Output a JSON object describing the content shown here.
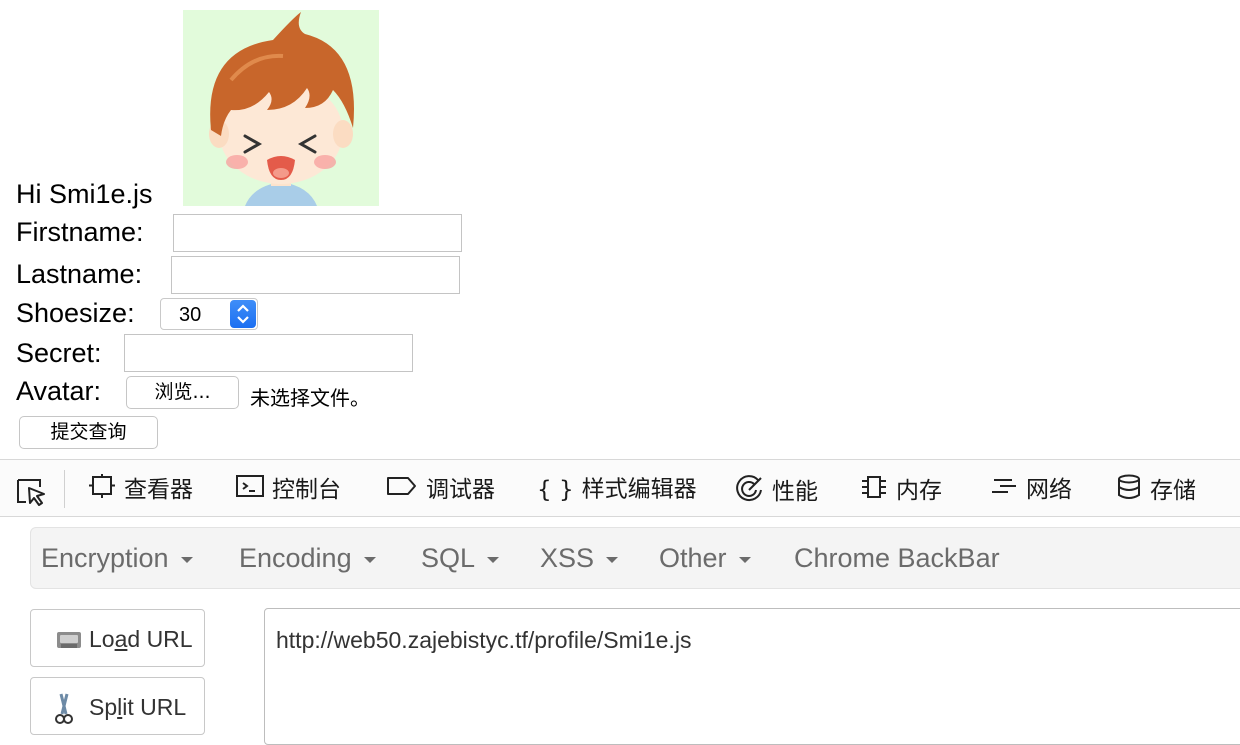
{
  "profile": {
    "greeting": "Hi Smi1e.js",
    "firstname_label": "Firstname:",
    "firstname_value": "",
    "lastname_label": "Lastname:",
    "lastname_value": "",
    "shoesize_label": "Shoesize:",
    "shoesize_value": "30",
    "secret_label": "Secret:",
    "secret_value": "",
    "avatar_label": "Avatar:",
    "browse_label": "浏览...",
    "file_status": "未选择文件。",
    "submit_label": "提交查询"
  },
  "devtools": {
    "tabs": [
      {
        "label": "查看器",
        "icon": "inspector-icon"
      },
      {
        "label": "控制台",
        "icon": "console-icon"
      },
      {
        "label": "调试器",
        "icon": "debugger-icon"
      },
      {
        "label": "样式编辑器",
        "icon": "style-editor-icon"
      },
      {
        "label": "性能",
        "icon": "performance-icon"
      },
      {
        "label": "内存",
        "icon": "memory-icon"
      },
      {
        "label": "网络",
        "icon": "network-icon"
      },
      {
        "label": "存储",
        "icon": "storage-icon"
      }
    ],
    "style_icon_glyph": "{ }"
  },
  "hackbar": {
    "menu": [
      {
        "label": "Encryption"
      },
      {
        "label": "Encoding"
      },
      {
        "label": "SQL"
      },
      {
        "label": "XSS"
      },
      {
        "label": "Other"
      },
      {
        "label": "Chrome BackBar"
      }
    ],
    "load_url": {
      "pre": "Lo",
      "key": "a",
      "post": "d URL"
    },
    "split_url": {
      "pre": "Sp",
      "key": "l",
      "post": "it URL"
    },
    "url": "http://web50.zajebistyc.tf/profile/Smi1e.js"
  }
}
